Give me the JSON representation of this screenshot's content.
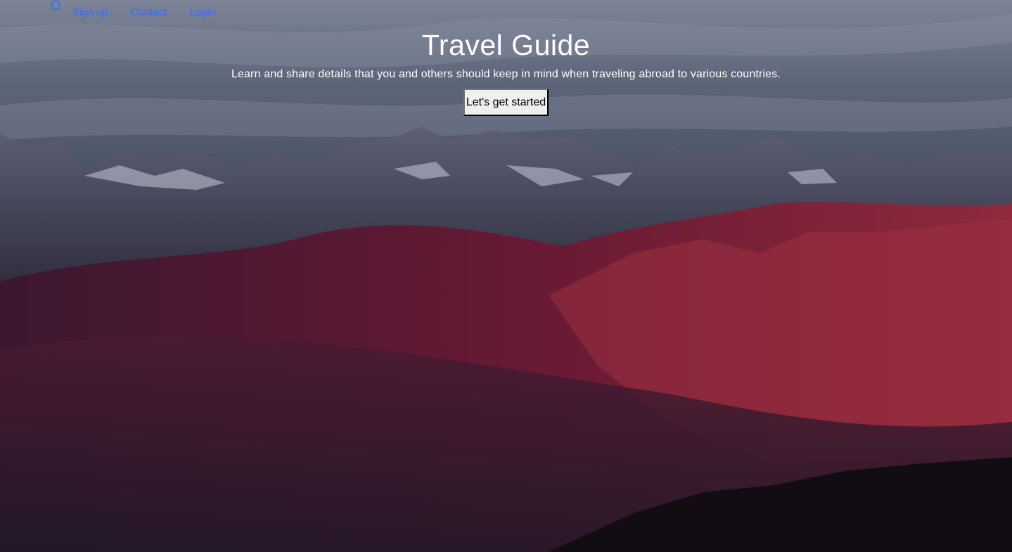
{
  "nav": {
    "home_icon": "home-icon",
    "links": [
      "Sign up",
      "Contact",
      "Login"
    ]
  },
  "hero": {
    "title": "Travel Guide",
    "subtitle": "Learn and share details that you and others should keep in mind when traveling abroad to various countries.",
    "cta_label": "Let's get started"
  },
  "colors": {
    "nav_link": "#2f6bff",
    "hero_text": "#ffffff",
    "button_bg": "#efefef"
  }
}
